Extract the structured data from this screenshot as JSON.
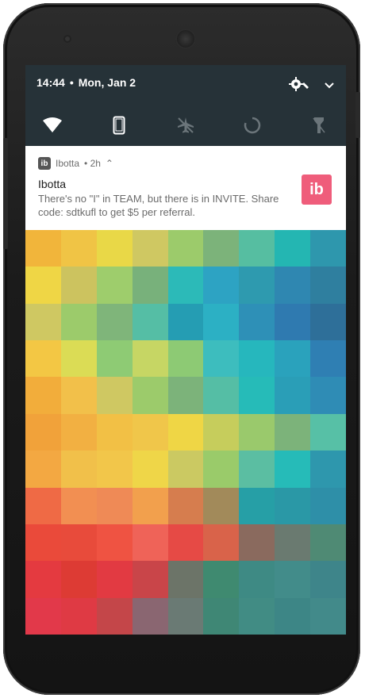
{
  "status": {
    "time": "14:44",
    "separator": "•",
    "date": "Mon, Jan 2"
  },
  "quick_settings": {
    "icons": [
      "wifi-icon",
      "phone-icon",
      "airplane-mode-icon",
      "rotate-icon",
      "flashlight-icon"
    ],
    "header_icons": [
      "settings-gear-icon",
      "wrench-icon",
      "chevron-down-icon"
    ]
  },
  "notification": {
    "app_icon_text": "ib",
    "app_name": "Ibotta",
    "time": "• 2h",
    "expand": "⌃",
    "title": "Ibotta",
    "text": "There's no \"I\" in TEAM, but there is in INVITE. Share code: sdtkufl to get $5 per referral.",
    "large_icon_text": "ib",
    "large_icon_color": "#ef5d7b"
  },
  "wallpaper": {
    "colors": [
      [
        "#f1b53b",
        "#f0c445",
        "#e9d847",
        "#cfc862",
        "#9ccb6b",
        "#7cb37a",
        "#56bea1",
        "#24b6b2",
        "#2e97ad"
      ],
      [
        "#efd645",
        "#ccc35f",
        "#9ecd6c",
        "#78b17b",
        "#2cbab8",
        "#2da3c3",
        "#2e9aaf",
        "#2f87b1",
        "#2f7f9f"
      ],
      [
        "#cfc862",
        "#9ccb6b",
        "#7fb57a",
        "#55bea5",
        "#259db3",
        "#2cb0c4",
        "#2e90b7",
        "#2f7ab0",
        "#2e6f99"
      ],
      [
        "#f3c744",
        "#dbdc55",
        "#8ecb74",
        "#c6d664",
        "#8dca74",
        "#3dbdbe",
        "#26b7bd",
        "#2aa2bc",
        "#2f7fb3"
      ],
      [
        "#f2ad3b",
        "#f2c04a",
        "#cfc862",
        "#9ccb6b",
        "#7cb37a",
        "#55bea5",
        "#26bbb8",
        "#2a9eb7",
        "#2f8cb5"
      ],
      [
        "#f1a23a",
        "#f2b042",
        "#f2c045",
        "#f0c64a",
        "#efd645",
        "#c6cd5c",
        "#9ac96c",
        "#7cb37a",
        "#57c0a6"
      ],
      [
        "#f3a842",
        "#f1c04a",
        "#f2c64a",
        "#efd648",
        "#cbc962",
        "#9acb6a",
        "#5bbea2",
        "#26bbb8",
        "#2e97ad"
      ],
      [
        "#ef6a45",
        "#f28f52",
        "#ef8a56",
        "#f2a04d",
        "#d67d4e",
        "#a28a5a",
        "#269fa6",
        "#2a98a6",
        "#2e8fa8"
      ],
      [
        "#ea4a3a",
        "#e84b3b",
        "#ef5342",
        "#ef6358",
        "#e64a45",
        "#d9634a",
        "#8a6a5e",
        "#6a7a70",
        "#4f8a74"
      ],
      [
        "#e43a40",
        "#dd3b34",
        "#e23a42",
        "#c94549",
        "#6c7468",
        "#3f8a70",
        "#3e8a84",
        "#428c8a",
        "#3e858a"
      ],
      [
        "#e2394a",
        "#df3a44",
        "#c44649",
        "#8a6671",
        "#6a7a74",
        "#3f8775",
        "#418c84",
        "#3d8686",
        "#428a8a"
      ]
    ]
  }
}
